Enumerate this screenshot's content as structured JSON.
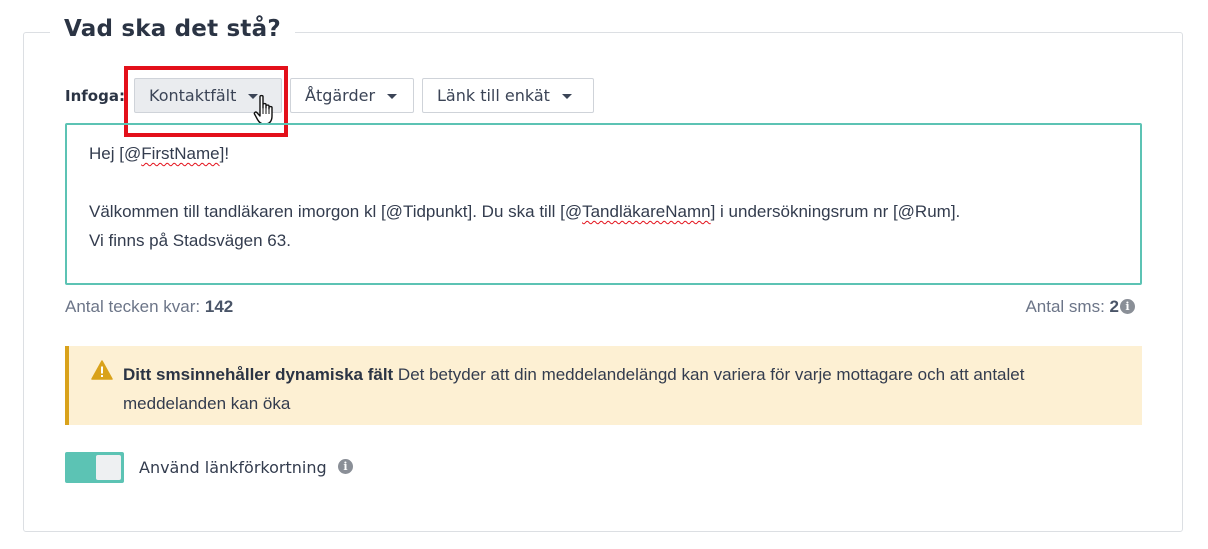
{
  "section": {
    "title": "Vad ska det stå?"
  },
  "toolbar": {
    "insert_label": "Infoga:",
    "contact_fields_label": "Kontaktfält",
    "actions_label": "Åtgärder",
    "survey_link_label": "Länk till enkät"
  },
  "message": {
    "line1_prefix": "Hej [@",
    "line1_field": "FirstName",
    "line1_suffix": "]!",
    "line2_part1": "Välkommen till tandläkaren imorgon kl [@Tidpunkt]. Du ska till [@",
    "line2_field": "TandläkareNamn",
    "line2_part2": "] i undersökningsrum nr [@Rum].",
    "line3": "Vi finns på Stadsvägen 63."
  },
  "counters": {
    "chars_left_label": "Antal tecken kvar:",
    "chars_left_value": "142",
    "sms_count_label": "Antal sms:",
    "sms_count_value": "2"
  },
  "warning": {
    "title": "Ditt smsinnehåller dynamiska fält",
    "body": " Det betyder att din meddelandelängd kan variera för varje mottagare och att antalet meddelanden kan öka",
    "color": "#d9a21b"
  },
  "link_shortening": {
    "label": "Använd länkförkortning",
    "enabled": true
  },
  "colors": {
    "accent": "#5cc3b4",
    "highlight": "#e3101a",
    "warning_bg": "#fdf0d3"
  }
}
